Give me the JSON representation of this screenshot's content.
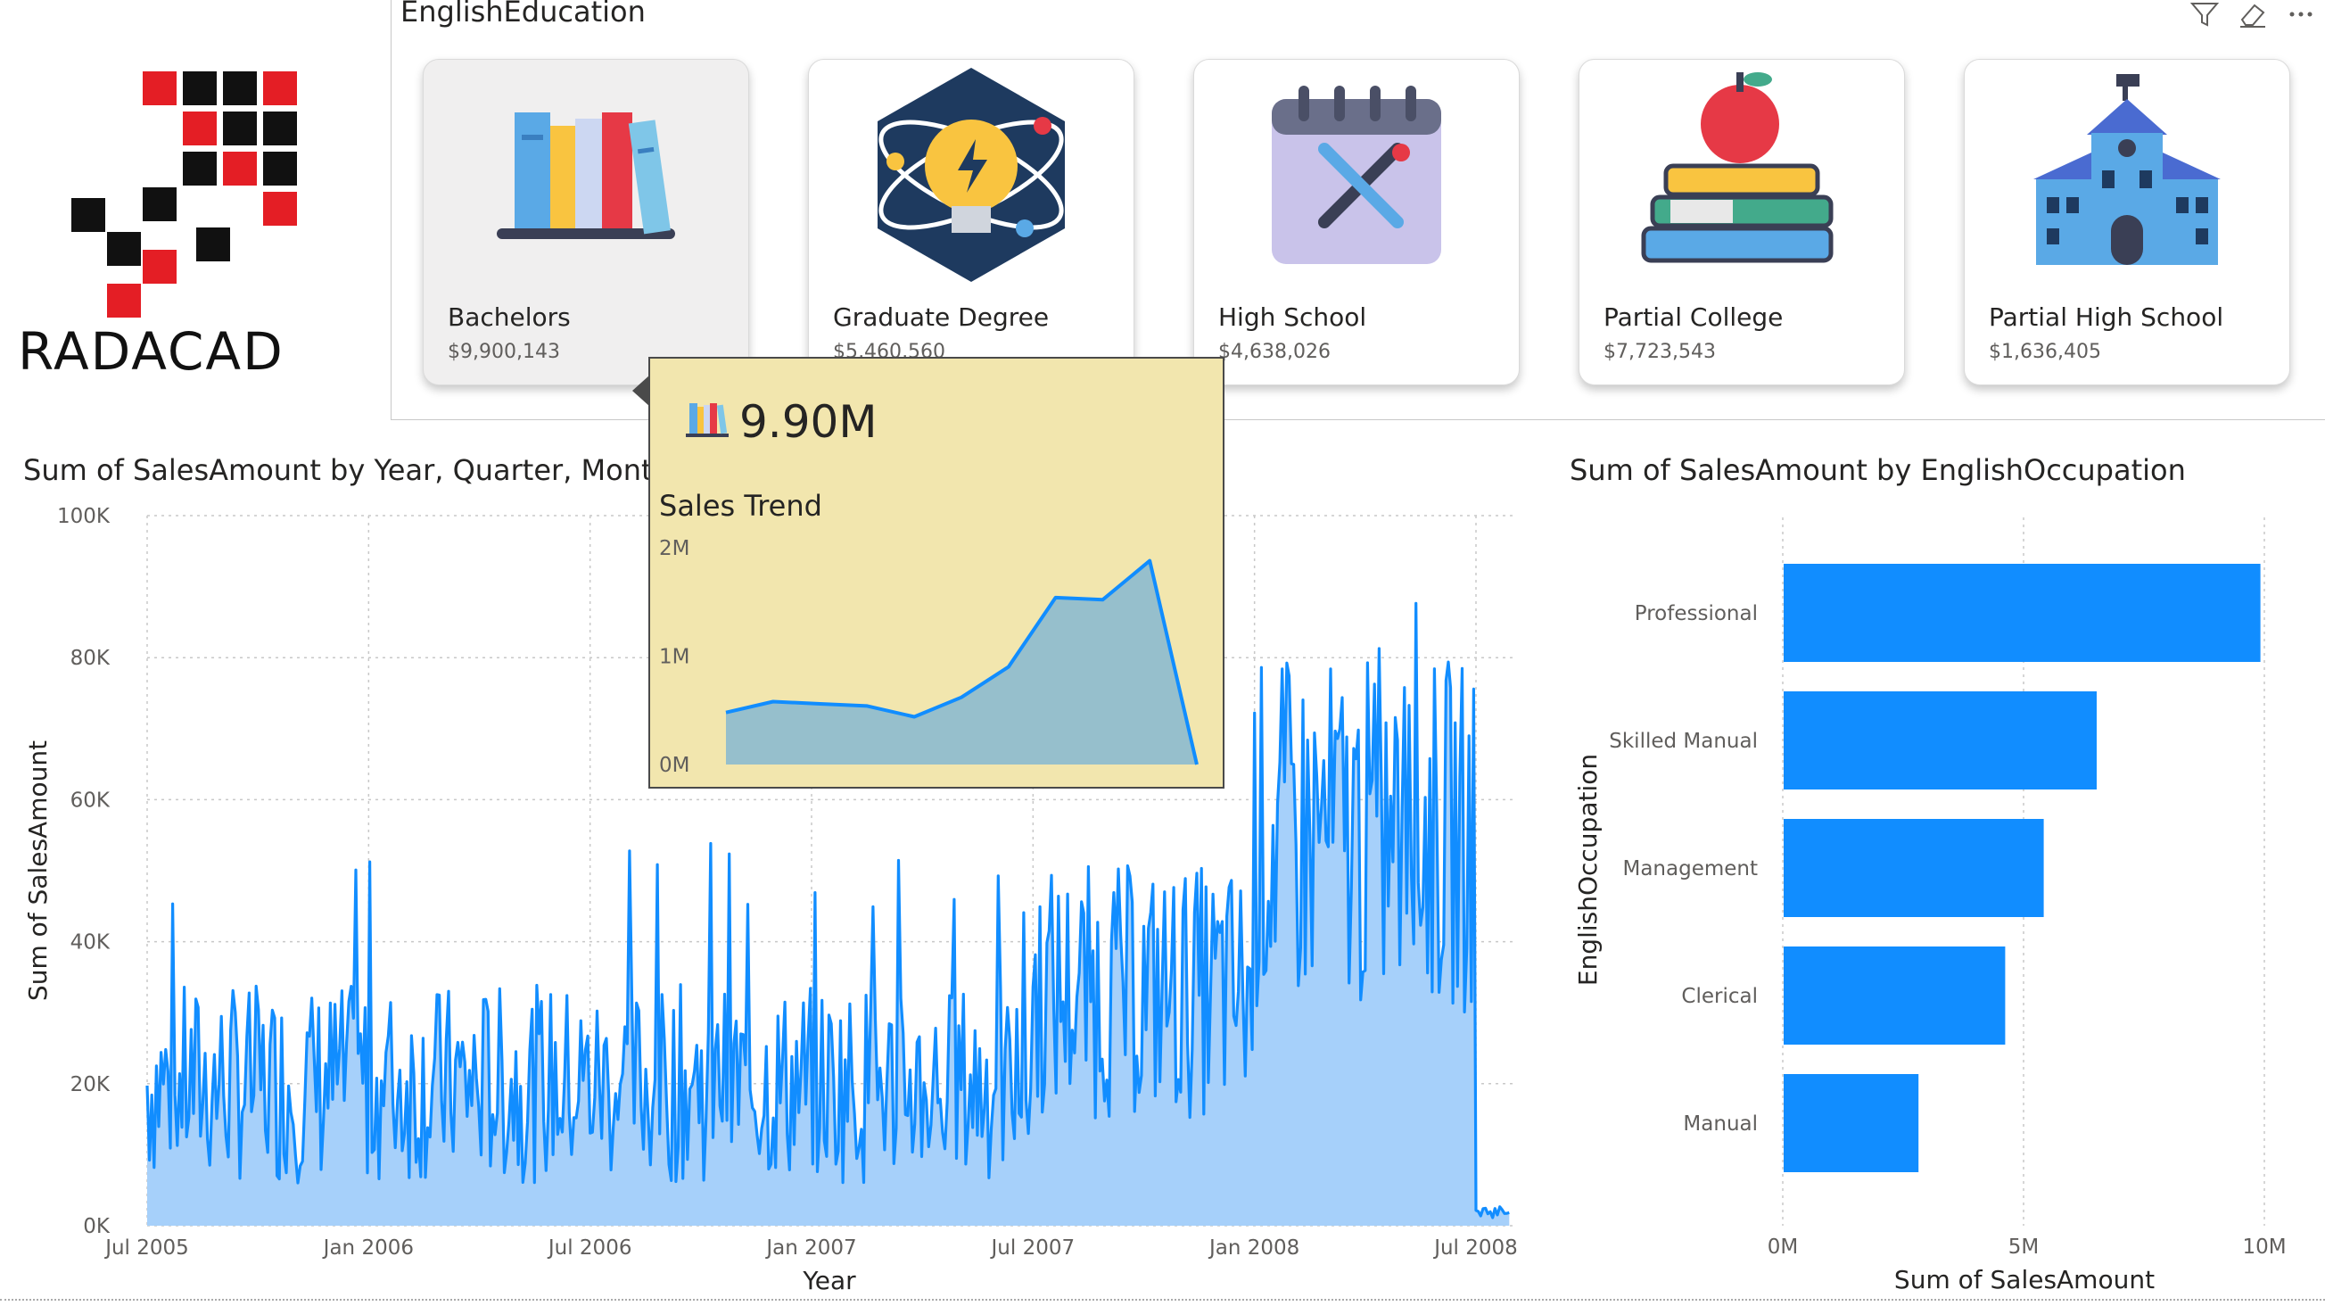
{
  "logo": {
    "text": "RADACAD"
  },
  "slicer": {
    "title": "EnglishEducation",
    "icons": [
      "filter-icon",
      "eraser-icon",
      "more-options-icon"
    ],
    "cards": [
      {
        "label": "Bachelors",
        "value": "$9,900,143",
        "icon": "books-icon",
        "selected": true
      },
      {
        "label": "Graduate Degree",
        "value": "$5,460,560",
        "icon": "lightbulb-atom-icon",
        "selected": false
      },
      {
        "label": "High School",
        "value": "$4,638,026",
        "icon": "calendar-pencil-icon",
        "selected": false
      },
      {
        "label": "Partial College",
        "value": "$7,723,543",
        "icon": "apple-books-icon",
        "selected": false
      },
      {
        "label": "Partial High School",
        "value": "$1,636,405",
        "icon": "school-building-icon",
        "selected": false
      }
    ]
  },
  "tooltip": {
    "value": "9.90M",
    "subtitle": "Sales Trend",
    "icon": "books-icon",
    "chart_data": {
      "type": "area",
      "y_ticks": [
        "2M",
        "1M",
        "0M"
      ],
      "ylim": [
        0,
        2000000
      ],
      "values": [
        480000,
        580000,
        560000,
        540000,
        440000,
        620000,
        900000,
        1540000,
        1520000,
        1880000,
        0
      ]
    }
  },
  "line_chart": {
    "title": "Sum of SalesAmount by Year, Quarter, Month a",
    "chart_data": {
      "type": "area",
      "xlabel": "Year",
      "ylabel": "Sum of SalesAmount",
      "ylim": [
        0,
        100000
      ],
      "y_ticks": [
        "100K",
        "80K",
        "60K",
        "40K",
        "20K",
        "0K"
      ],
      "x_ticks": [
        "Jul 2005",
        "Jan 2006",
        "Jul 2006",
        "Jan 2007",
        "Jul 2007",
        "Jan 2008",
        "Jul 2008"
      ],
      "segments": [
        {
          "start": "Jul 2005",
          "end": "Jul 2007",
          "avg": 20000,
          "spread": 14000,
          "peak": 55000
        },
        {
          "start": "Jul 2007",
          "end": "Jan 2008",
          "avg": 33000,
          "spread": 18000,
          "peak": 67000
        },
        {
          "start": "Jan 2008",
          "end": "Jul 2008",
          "avg": 55000,
          "spread": 25000,
          "peak": 97000
        },
        {
          "start": "Jul 2008",
          "end": "Jul 2008",
          "avg": 2000,
          "spread": 1000,
          "peak": 3000
        }
      ],
      "colors": {
        "line": "#118dff",
        "area": "#a6d0fa"
      }
    }
  },
  "bar_chart": {
    "title": "Sum of SalesAmount by EnglishOccupation",
    "chart_data": {
      "type": "bar",
      "orientation": "horizontal",
      "xlabel": "Sum of SalesAmount",
      "ylabel": "EnglishOccupation",
      "categories": [
        "Professional",
        "Skilled Manual",
        "Management",
        "Clerical",
        "Manual"
      ],
      "values": [
        9900000,
        6500000,
        5400000,
        4600000,
        2800000
      ],
      "xlim": [
        0,
        10000000
      ],
      "x_ticks": [
        "0M",
        "5M",
        "10M"
      ],
      "color": "#118dff"
    }
  }
}
